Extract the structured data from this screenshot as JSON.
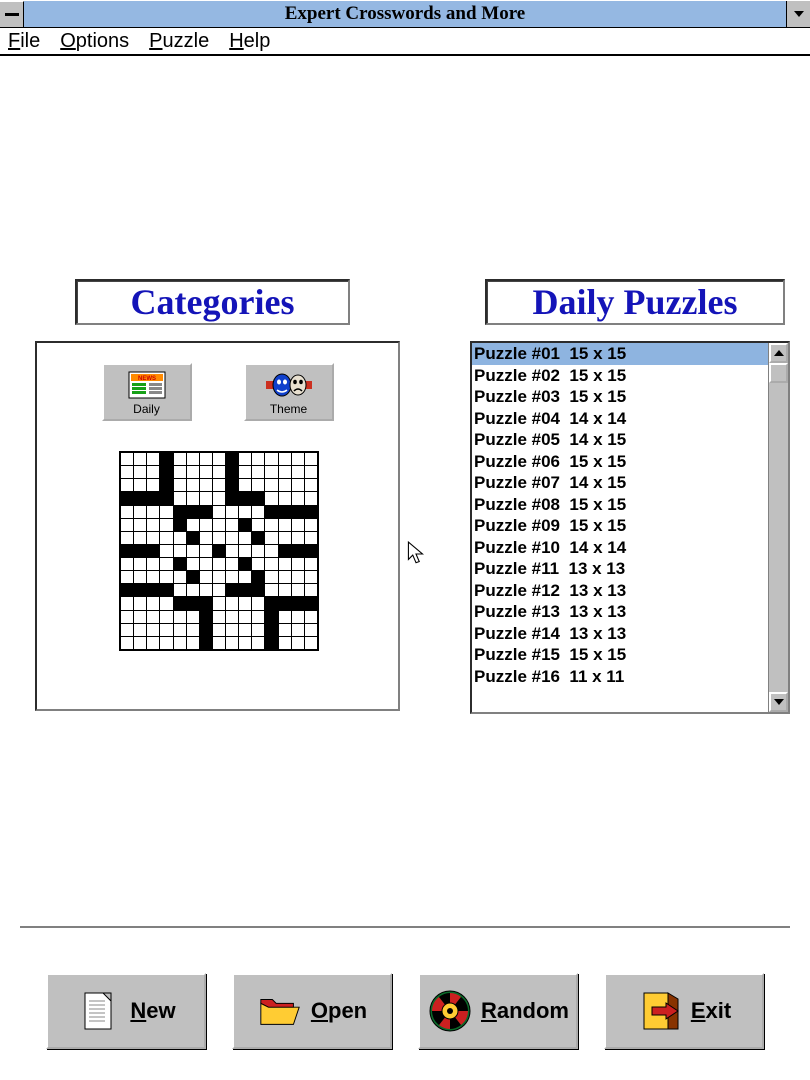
{
  "window": {
    "title": "Expert Crosswords and More"
  },
  "menu": {
    "file": "File",
    "options": "Options",
    "puzzle": "Puzzle",
    "help": "Help"
  },
  "headings": {
    "categories": "Categories",
    "daily_puzzles": "Daily Puzzles"
  },
  "category_buttons": {
    "daily": "Daily",
    "theme": "Theme"
  },
  "puzzle_list": [
    "Puzzle #01  15 x 15",
    "Puzzle #02  15 x 15",
    "Puzzle #03  15 x 15",
    "Puzzle #04  14 x 14",
    "Puzzle #05  14 x 15",
    "Puzzle #06  15 x 15",
    "Puzzle #07  14 x 15",
    "Puzzle #08  15 x 15",
    "Puzzle #09  15 x 15",
    "Puzzle #10  14 x 14",
    "Puzzle #11  13 x 13",
    "Puzzle #12  13 x 13",
    "Puzzle #13  13 x 13",
    "Puzzle #14  13 x 13",
    "Puzzle #15  15 x 15",
    "Puzzle #16  11 x 11"
  ],
  "selected_index": 0,
  "bottom_buttons": {
    "new": "New",
    "open": "Open",
    "random": "Random",
    "exit": "Exit"
  },
  "crossword_grid": [
    "...X....X......",
    "...X....X......",
    "...X....X......",
    "XXXX....XXX....",
    "....XXX....XXXX",
    "....X....X.....",
    ".....X....X....",
    "XXX....X....XXX",
    "....X....X.....",
    ".....X....X....",
    "XXXX....XXX....",
    "....XXX....XXXX",
    "......X....X...",
    "......X....X...",
    "......X....X..."
  ]
}
